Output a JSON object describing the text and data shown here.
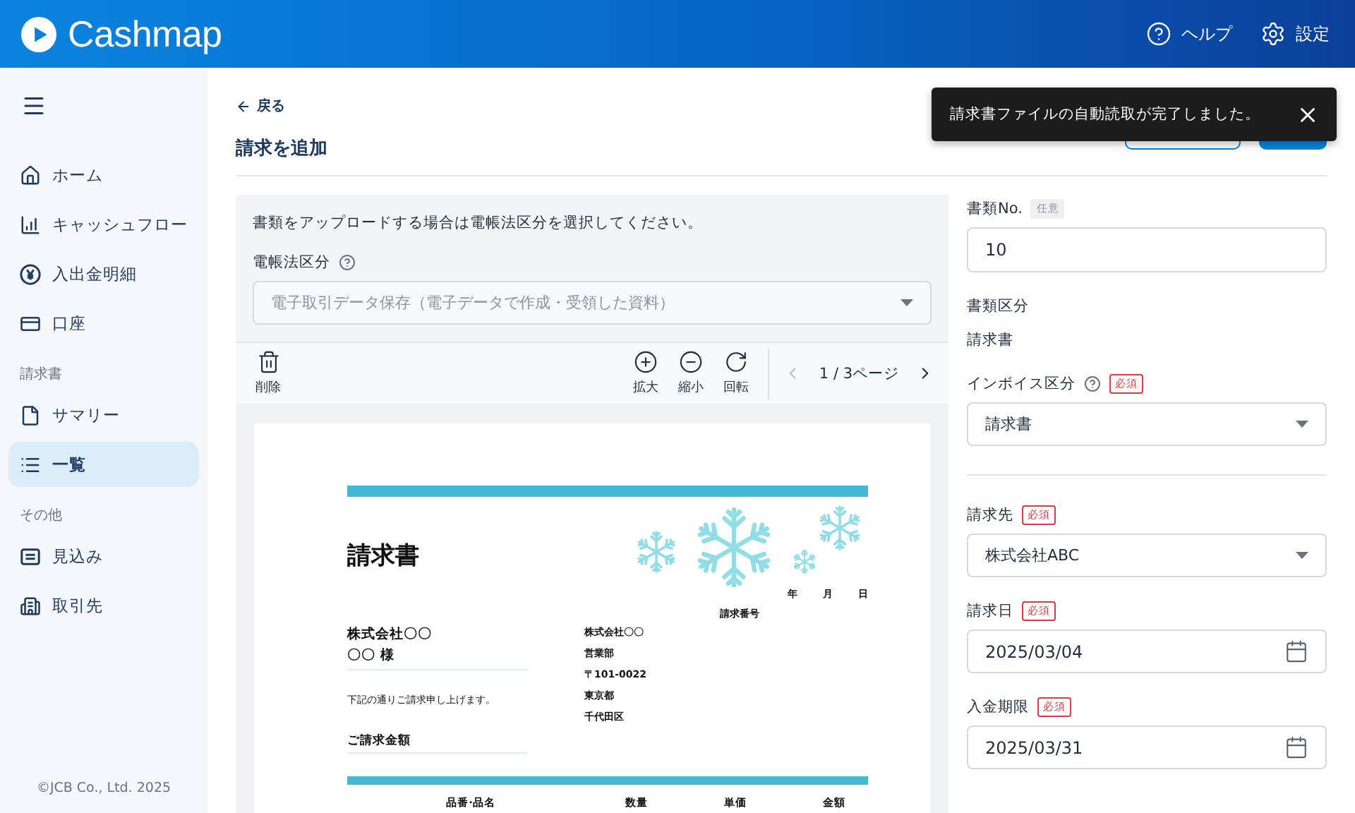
{
  "header": {
    "logo": "Cashmap",
    "actions": [
      {
        "kind": "help",
        "label": "ヘルプ"
      },
      {
        "kind": "settings",
        "label": "設定"
      }
    ]
  },
  "sidebar": {
    "sections": [
      {
        "items": [
          {
            "kind": "home",
            "label": "ホーム",
            "selected": false
          },
          {
            "kind": "chart",
            "label": "キャッシュフロー",
            "selected": false
          },
          {
            "kind": "yen",
            "label": "入出金明細",
            "selected": false
          },
          {
            "kind": "card",
            "label": "口座",
            "selected": false
          }
        ]
      },
      {
        "heading": "請求書",
        "items": [
          {
            "kind": "file",
            "label": "サマリー",
            "selected": false
          },
          {
            "kind": "list",
            "label": "一覧",
            "selected": true
          }
        ]
      },
      {
        "heading": "その他",
        "items": [
          {
            "kind": "board",
            "label": "見込み",
            "selected": false
          },
          {
            "kind": "building",
            "label": "取引先",
            "selected": false
          }
        ]
      }
    ],
    "copyright": "©JCB Co., Ltd. 2025"
  },
  "page": {
    "back": "戻る",
    "title": "請求を追加",
    "buttons": [
      {
        "kind": "outline"
      },
      {
        "kind": "primary"
      }
    ],
    "toast": {
      "message": "請求書ファイルの自動読取が完了しました。"
    }
  },
  "upload": {
    "instruction": "書類をアップロードする場合は電帳法区分を選択してください。",
    "field_label": "電帳法区分",
    "select_placeholder": "電子取引データ保存（電子データで作成・受領した資料）",
    "tools": [
      {
        "kind": "delete",
        "label": "削除"
      },
      {
        "kind": "zoom-in",
        "label": "拡大"
      },
      {
        "kind": "zoom-out",
        "label": "縮小"
      },
      {
        "kind": "rotate",
        "label": "回転"
      }
    ],
    "pager": "1 / 3ページ"
  },
  "document": {
    "title": "請求書",
    "recipient_company": "株式会社〇〇",
    "recipient_name": "〇〇 様",
    "note": "下記の通りご請求申し上げます。",
    "amount_label": "ご請求金額",
    "date_parts": [
      "年",
      "月",
      "日"
    ],
    "number_label": "請求番号",
    "issuer": [
      "株式会社〇〇",
      "営業部",
      "〒101-0022",
      "東京都",
      "千代田区"
    ],
    "columns": [
      "品番·品名",
      "数量",
      "単価",
      "金額"
    ]
  },
  "form": {
    "groups": [
      [
        {
          "kind": "input",
          "label": "書類No.",
          "badge": {
            "kind": "optional",
            "text": "任意"
          },
          "value": "10"
        },
        {
          "kind": "static",
          "label": "書類区分",
          "value": "請求書"
        },
        {
          "kind": "select",
          "label": "インボイス区分",
          "help": true,
          "badge": {
            "kind": "required",
            "text": "必須"
          },
          "value": "請求書"
        }
      ],
      [
        {
          "kind": "select",
          "label": "請求先",
          "badge": {
            "kind": "required",
            "text": "必須"
          },
          "value": "株式会社ABC"
        },
        {
          "kind": "date",
          "label": "請求日",
          "badge": {
            "kind": "required",
            "text": "必須"
          },
          "value": "2025/03/04"
        },
        {
          "kind": "date",
          "label": "入金期限",
          "badge": {
            "kind": "required",
            "text": "必須"
          },
          "value": "2025/03/31"
        }
      ]
    ]
  }
}
